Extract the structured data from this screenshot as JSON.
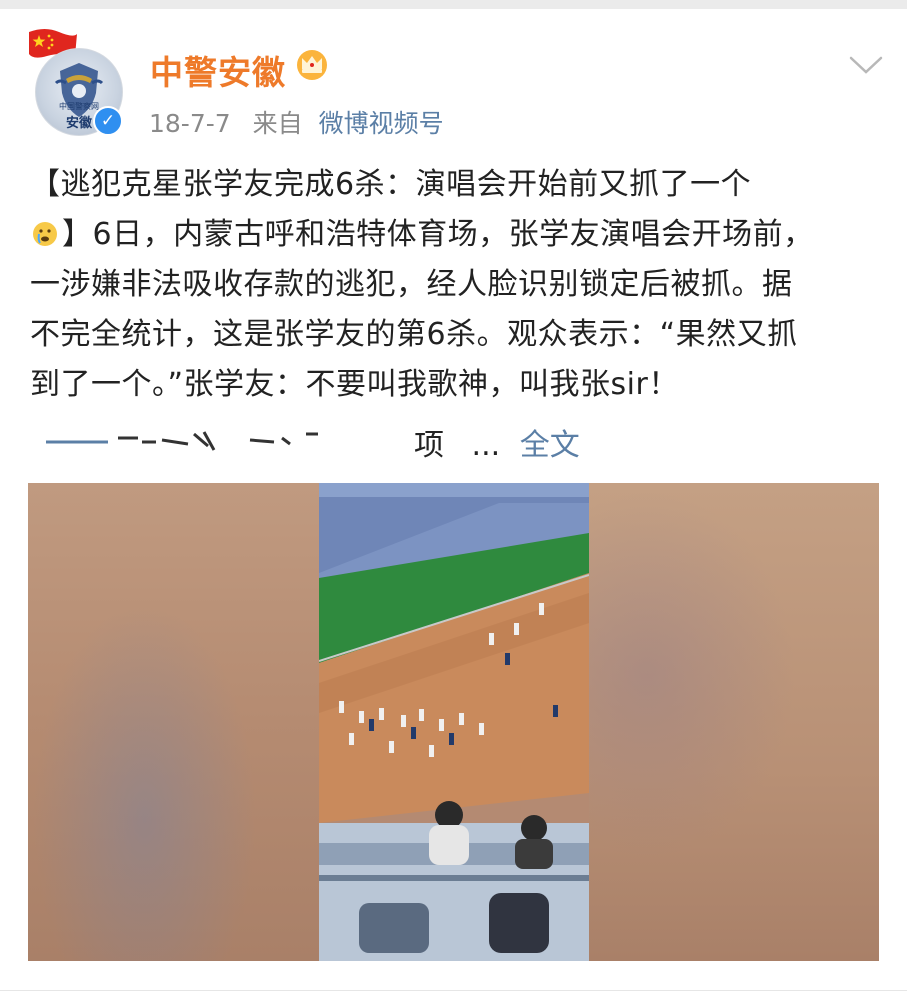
{
  "account": {
    "name": "中警安徽",
    "avatar_text_top": "中国警察网",
    "avatar_text_bottom": "安徽",
    "verified": true,
    "flag_icon": "china-flag-icon",
    "crown_icon": "vip-crown-icon"
  },
  "post": {
    "date": "18-7-7",
    "source_prefix": "来自",
    "source": "微博视频号",
    "body_line1": "【逃犯克星张学友完成6杀：演唱会开始前又抓了一个",
    "body_line2": "】6日，内蒙古呼和浩特体育场，张学友演唱会开场前，",
    "body_line3": "一涉嫌非法吸收存款的逃犯，经人脸识别锁定后被抓。据",
    "body_line4": "不完全统计，这是张学友的第6杀。观众表示：“果然又抓",
    "body_line5": "到了一个。”张学友：不要叫我歌神，叫我张sir！",
    "truncated_fragment": "项",
    "ellipsis": "...",
    "expand_label": "全文"
  },
  "colors": {
    "name": "#ee7a2a",
    "link": "#5b7fa6",
    "meta": "#8a8a8a",
    "text": "#222222",
    "verified": "#2f8ff0"
  },
  "media": {
    "type": "video",
    "description_icon": "stadium-video-thumbnail"
  }
}
